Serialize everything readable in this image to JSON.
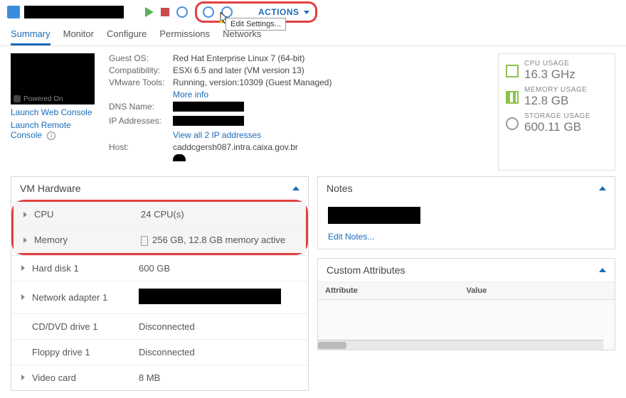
{
  "topbar": {
    "actions_label": "ACTIONS",
    "tooltip": "Edit Settings..."
  },
  "tabs": [
    "Summary",
    "Monitor",
    "Configure",
    "Permissions",
    "Networks"
  ],
  "active_tab": "Summary",
  "console": {
    "status": "Powered On",
    "launch_web": "Launch Web Console",
    "launch_remote": "Launch Remote Console"
  },
  "info": {
    "guest_os_label": "Guest OS:",
    "guest_os": "Red Hat Enterprise Linux 7 (64-bit)",
    "compat_label": "Compatibility:",
    "compat": "ESXi 6.5 and later (VM version 13)",
    "tools_label": "VMware Tools:",
    "tools": "Running, version:10309 (Guest Managed)",
    "more_info": "More info",
    "dns_label": "DNS Name:",
    "ip_label": "IP Addresses:",
    "view_ips": "View all 2 IP addresses",
    "host_label": "Host:",
    "host": "caddcgersh087.intra.caixa.gov.br"
  },
  "usage": {
    "cpu_label": "CPU USAGE",
    "cpu": "16.3 GHz",
    "mem_label": "MEMORY USAGE",
    "mem": "12.8 GB",
    "storage_label": "STORAGE USAGE",
    "storage": "600.11 GB"
  },
  "panels": {
    "hw_title": "VM Hardware",
    "notes_title": "Notes",
    "edit_notes": "Edit Notes...",
    "attr_title": "Custom Attributes",
    "attr_col1": "Attribute",
    "attr_col2": "Value"
  },
  "hw": [
    {
      "label": "CPU",
      "value": "24 CPU(s)",
      "expandable": true,
      "highlight": true
    },
    {
      "label": "Memory",
      "value": "256 GB, 12.8 GB memory active",
      "expandable": true,
      "highlight": true,
      "icon": true
    },
    {
      "label": "Hard disk 1",
      "value": "600 GB",
      "expandable": true
    },
    {
      "label": "Network adapter 1",
      "value": "",
      "expandable": true,
      "redacted": true
    },
    {
      "label": "CD/DVD drive 1",
      "value": "Disconnected",
      "expandable": false
    },
    {
      "label": "Floppy drive 1",
      "value": "Disconnected",
      "expandable": false
    },
    {
      "label": "Video card",
      "value": "8 MB",
      "expandable": true
    }
  ]
}
